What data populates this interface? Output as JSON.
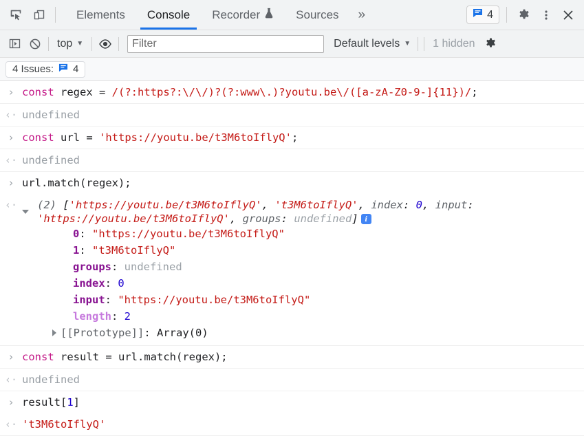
{
  "tabbar": {
    "icons": [
      {
        "name": "inspect-element-icon"
      },
      {
        "name": "device-toolbar-icon"
      }
    ],
    "tabs": [
      {
        "label": "Elements",
        "active": false
      },
      {
        "label": "Console",
        "active": true
      },
      {
        "label": "Recorder",
        "active": false,
        "icon": "flask-icon"
      },
      {
        "label": "Sources",
        "active": false
      }
    ],
    "more_label": "»",
    "issue_chip": {
      "count": "4",
      "icon": "message-icon"
    },
    "settings_label": "gear-icon",
    "menu_label": "kebab-menu-icon",
    "close_label": "close-icon"
  },
  "filterbar": {
    "sidebar_toggle": "console-sidebar-icon",
    "clear_console": "clear-console-icon",
    "context": "top",
    "caret": "▼",
    "eye": "live-expression-icon",
    "filter_placeholder": "Filter",
    "filter_value": "",
    "levels": "Default levels",
    "hidden": "1 hidden",
    "settings": "gear-icon"
  },
  "issuesbar": {
    "label": "4 Issues:",
    "count": "4",
    "icon": "message-icon"
  },
  "console": {
    "prompt_glyph": "›",
    "output_glyph": "‹·",
    "entries": [
      {
        "type": "input",
        "kw": "const",
        "name": " regex ",
        "eq": "= ",
        "regex": "/(?:https?:\\/\\/)?(?:www\\.)?youtu.be\\/([a-zA-Z0-9-]{11})/",
        "semi": ";"
      },
      {
        "type": "output",
        "text": "undefined"
      },
      {
        "type": "input",
        "kw": "const",
        "name": " url ",
        "eq": "= ",
        "str": "'https://youtu.be/t3M6toIflyQ'",
        "semi": ";"
      },
      {
        "type": "output",
        "text": "undefined"
      },
      {
        "type": "input_plain",
        "text": "url.match(regex);"
      },
      {
        "type": "object",
        "preview": {
          "count": "(2)",
          "open": " [",
          "items": [
            {
              "kind": "str",
              "text": "'https://youtu.be/t3M6toIflyQ'"
            },
            {
              "kind": "sep",
              "text": ", "
            },
            {
              "kind": "str",
              "text": "'t3M6toIflyQ'"
            },
            {
              "kind": "sep",
              "text": ", "
            },
            {
              "kind": "key",
              "text": "index"
            },
            {
              "kind": "sep",
              "text": ": "
            },
            {
              "kind": "num",
              "text": "0"
            },
            {
              "kind": "sep",
              "text": ", "
            },
            {
              "kind": "key",
              "text": "input"
            },
            {
              "kind": "sep",
              "text": ": "
            },
            {
              "kind": "str",
              "text": "'https://youtu.be/t3M6toIflyQ'"
            },
            {
              "kind": "sep",
              "text": ", "
            },
            {
              "kind": "key",
              "text": "groups"
            },
            {
              "kind": "sep",
              "text": ": "
            },
            {
              "kind": "undef",
              "text": "undefined"
            },
            {
              "kind": "sep",
              "text": "]"
            }
          ]
        },
        "properties": [
          {
            "key": "0",
            "keyclass": "k-prop",
            "val": "\"https://youtu.be/t3M6toIflyQ\"",
            "valclass": "k-str"
          },
          {
            "key": "1",
            "keyclass": "k-prop",
            "val": "\"t3M6toIflyQ\"",
            "valclass": "k-str"
          },
          {
            "key": "groups",
            "keyclass": "k-prop",
            "val": "undefined",
            "valclass": "k-undef"
          },
          {
            "key": "index",
            "keyclass": "k-prop",
            "val": "0",
            "valclass": "k-num"
          },
          {
            "key": "input",
            "keyclass": "k-prop",
            "val": "\"https://youtu.be/t3M6toIflyQ\"",
            "valclass": "k-str"
          },
          {
            "key": "length",
            "keyclass": "k-propl",
            "val": "2",
            "valclass": "k-num"
          }
        ],
        "prototype": {
          "key": "[[Prototype]]",
          "val": "Array(0)"
        }
      },
      {
        "type": "input",
        "kw": "const",
        "name": " result ",
        "eq": "= ",
        "plain": "url.match(regex);"
      },
      {
        "type": "output",
        "text": "undefined"
      },
      {
        "type": "input_plain_idx",
        "base": "result[",
        "idx": "1",
        "close": "]"
      },
      {
        "type": "output_str",
        "text": "'t3M6toIflyQ'"
      }
    ]
  },
  "colors": {
    "accent": "#1a73e8",
    "toolbar_bg": "#f1f3f4",
    "string": "#c41a16",
    "keyword": "#c41a88",
    "number": "#1c00cf",
    "property": "#881391",
    "muted": "#9aa0a6"
  }
}
